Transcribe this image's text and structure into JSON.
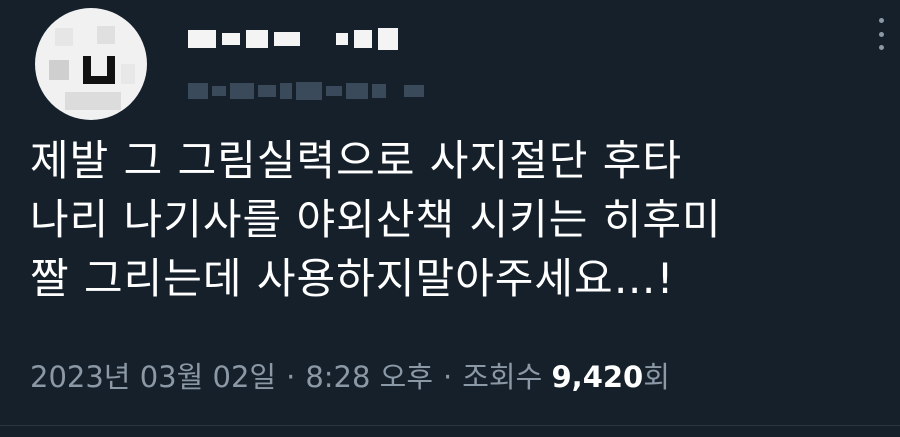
{
  "tweet": {
    "text": "제발 그 그림실력으로 사지절단  후타\n나리 나기사를 야외산책 시키는 히후미\n짤 그리는데 사용하지말아주세요…!",
    "date": "2023년 03월 02일",
    "separator": "·",
    "time": "8:28 오후",
    "views_label": "조회수",
    "views_count": "9,420",
    "views_suffix": "회"
  },
  "icons": {
    "more": "more-vertical-icon",
    "avatar": "avatar-blurred"
  },
  "colors": {
    "background": "#15202b",
    "text": "#ffffff",
    "secondary": "#8b98a5"
  }
}
